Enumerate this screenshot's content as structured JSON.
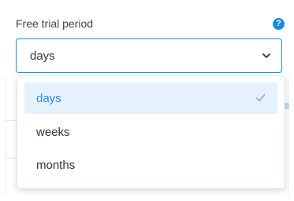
{
  "field": {
    "label": "Free trial period",
    "help_icon": "?",
    "selected_value": "days"
  },
  "dropdown": {
    "options": [
      {
        "label": "days",
        "selected": true
      },
      {
        "label": "weeks",
        "selected": false
      },
      {
        "label": "months",
        "selected": false
      }
    ]
  },
  "icons": {
    "help": "question-circle-icon",
    "chevron": "chevron-down-icon",
    "check": "check-icon"
  },
  "colors": {
    "accent": "#1f8ae8",
    "selected_bg": "#e5f2fd",
    "selected_text": "#2a8ae6",
    "text": "#2b3240",
    "label_text": "#3c4454"
  }
}
